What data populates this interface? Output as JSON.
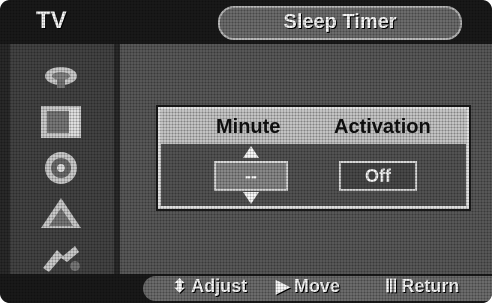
{
  "header": {
    "menu_title": "TV",
    "screen_title": "Sleep Timer"
  },
  "sidebar": {
    "items": [
      {
        "icon": "satellite-dish-icon"
      },
      {
        "icon": "picture-screen-icon"
      },
      {
        "icon": "speaker-icon"
      },
      {
        "icon": "channel-icon"
      },
      {
        "icon": "setup-icon"
      }
    ]
  },
  "dialog": {
    "minute_label": "Minute",
    "activation_label": "Activation",
    "minute_value": "--",
    "activation_value": "Off"
  },
  "footer": {
    "adjust_glyph": "⬍",
    "adjust_label": "Adjust",
    "move_glyph": "▶",
    "move_label": "Move",
    "return_glyph": "Ⅲ",
    "return_label": "Return"
  }
}
